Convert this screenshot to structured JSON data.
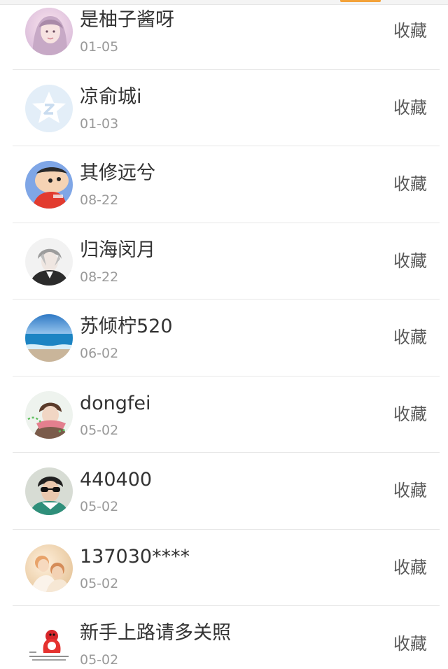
{
  "list": {
    "items": [
      {
        "name": "是柚子酱呀",
        "date": "01-05",
        "action": "收藏",
        "avatar_icon": "girl-portrait-avatar"
      },
      {
        "name": "凉俞城i",
        "date": "01-03",
        "action": "收藏",
        "avatar_icon": "default-star-avatar"
      },
      {
        "name": "其修远兮",
        "date": "08-22",
        "action": "收藏",
        "avatar_icon": "cartoon-boy-avatar"
      },
      {
        "name": "归海闵月",
        "date": "08-22",
        "action": "收藏",
        "avatar_icon": "anime-character-avatar"
      },
      {
        "name": "苏倾柠520",
        "date": "06-02",
        "action": "收藏",
        "avatar_icon": "sea-beach-avatar"
      },
      {
        "name": "dongfei",
        "date": "05-02",
        "action": "收藏",
        "avatar_icon": "boy-scarf-avatar"
      },
      {
        "name": "440400",
        "date": "05-02",
        "action": "收藏",
        "avatar_icon": "man-sunglasses-avatar"
      },
      {
        "name": "137030****",
        "date": "05-02",
        "action": "收藏",
        "avatar_icon": "couple-avatar"
      },
      {
        "name": "新手上路请多关照",
        "date": "05-02",
        "action": "收藏",
        "avatar_icon": "red-bird-avatar"
      }
    ]
  },
  "colors": {
    "name_text": "#333333",
    "date_text": "#9a9a9a",
    "action_text": "#5a5a5a",
    "divider": "#e7e7e7",
    "top_accent": "#f3a23a"
  }
}
